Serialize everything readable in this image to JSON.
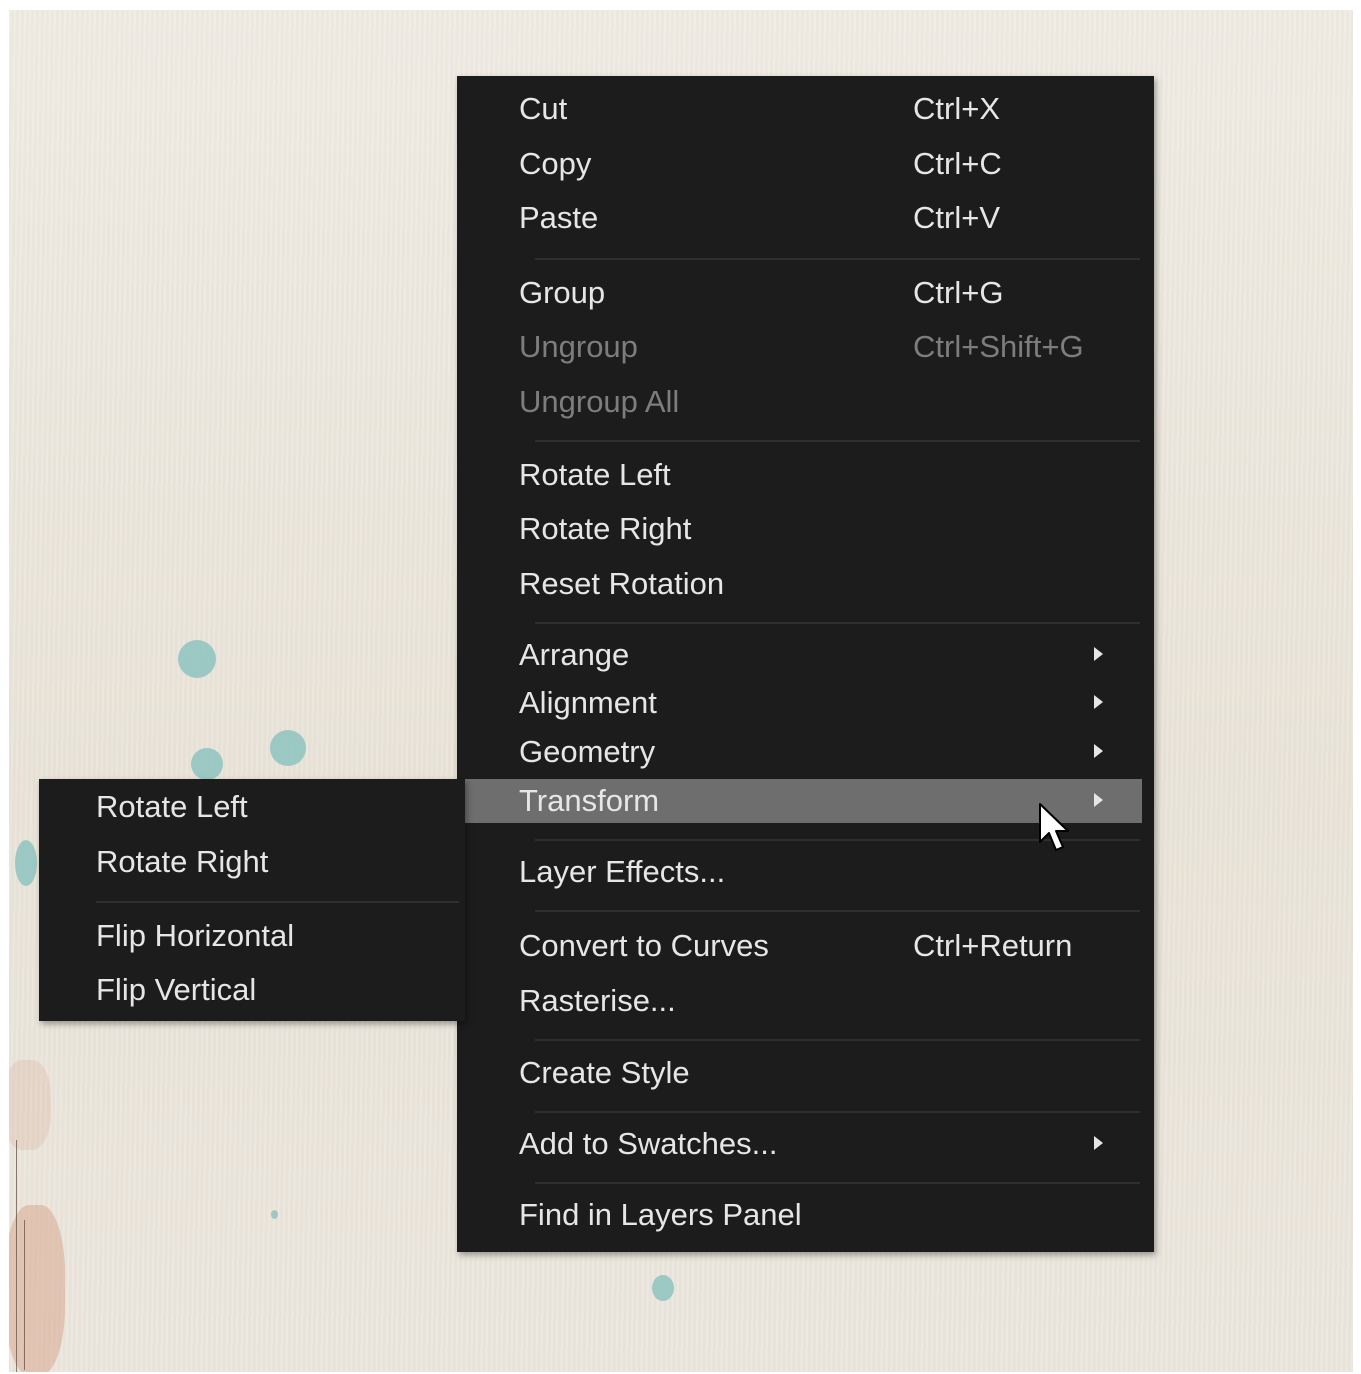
{
  "context_menu": {
    "items": [
      {
        "label": "Cut",
        "shortcut": "Ctrl+X"
      },
      {
        "label": "Copy",
        "shortcut": "Ctrl+C"
      },
      {
        "label": "Paste",
        "shortcut": "Ctrl+V"
      },
      {
        "label": "Group",
        "shortcut": "Ctrl+G"
      },
      {
        "label": "Ungroup",
        "shortcut": "Ctrl+Shift+G",
        "disabled": true
      },
      {
        "label": "Ungroup All",
        "disabled": true
      },
      {
        "label": "Rotate Left"
      },
      {
        "label": "Rotate Right"
      },
      {
        "label": "Reset Rotation"
      },
      {
        "label": "Arrange",
        "submenu": true
      },
      {
        "label": "Alignment",
        "submenu": true
      },
      {
        "label": "Geometry",
        "submenu": true
      },
      {
        "label": "Transform",
        "submenu": true,
        "highlighted": true
      },
      {
        "label": "Layer Effects..."
      },
      {
        "label": "Convert to Curves",
        "shortcut": "Ctrl+Return"
      },
      {
        "label": "Rasterise..."
      },
      {
        "label": "Create Style"
      },
      {
        "label": "Add to Swatches...",
        "submenu": true
      },
      {
        "label": "Find in Layers Panel"
      }
    ]
  },
  "transform_submenu": {
    "items": [
      {
        "label": "Rotate Left"
      },
      {
        "label": "Rotate Right"
      },
      {
        "label": "Flip Horizontal"
      },
      {
        "label": "Flip Vertical"
      }
    ]
  },
  "colors": {
    "menu_background": "#1c1c1c",
    "menu_text": "#e6e6e6",
    "disabled_text": "#7d7d7d",
    "highlight": "#6e6e6e",
    "canvas": "#ece7dd",
    "paint_spots": "#8ec3c0"
  },
  "icons": {
    "submenu_arrow": "triangle-right-icon",
    "pointer": "mouse-cursor-icon"
  }
}
